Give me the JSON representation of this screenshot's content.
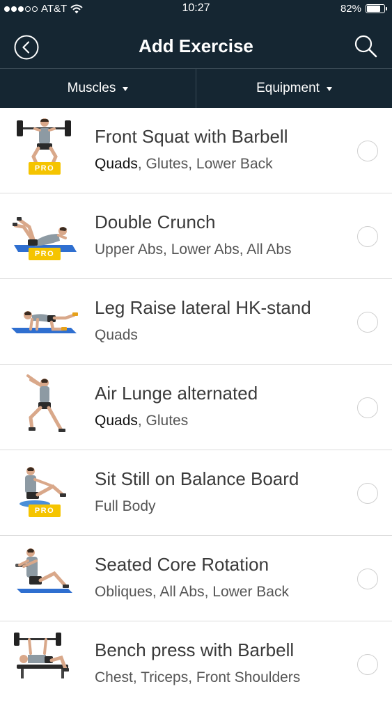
{
  "status_bar": {
    "carrier": "AT&T",
    "time": "10:27",
    "battery_percent": "82%",
    "battery_level": 0.82,
    "signal_bars_filled": 3,
    "signal_bars_total": 5
  },
  "navbar": {
    "title": "Add Exercise",
    "back_icon": "chevron-left-circle-icon",
    "search_icon": "search-icon"
  },
  "filters": {
    "muscles_label": "Muscles",
    "equipment_label": "Equipment"
  },
  "badge_label": "PRO",
  "colors": {
    "header_bg": "#152632",
    "pro_badge": "#f5c400",
    "mat_blue": "#2f6fd0"
  },
  "exercises": [
    {
      "name": "Front Squat with Barbell",
      "primary": "Quads",
      "secondary": ", Glutes, Lower Back",
      "pro": true,
      "illustration": "front-squat-barbell-figure"
    },
    {
      "name": "Double Crunch",
      "primary": "",
      "secondary": "Upper Abs, Lower Abs, All Abs",
      "pro": true,
      "illustration": "double-crunch-figure"
    },
    {
      "name": "Leg Raise lateral HK-stand",
      "primary": "",
      "secondary": "Quads",
      "pro": false,
      "illustration": "leg-raise-lateral-figure"
    },
    {
      "name": "Air Lunge alternated",
      "primary": "Quads",
      "secondary": ", Glutes",
      "pro": false,
      "illustration": "air-lunge-figure"
    },
    {
      "name": "Sit Still on Balance Board",
      "primary": "",
      "secondary": "Full Body",
      "pro": true,
      "illustration": "balance-board-figure"
    },
    {
      "name": "Seated Core Rotation",
      "primary": "",
      "secondary": "Obliques, All Abs, Lower Back",
      "pro": false,
      "illustration": "seated-core-rotation-figure"
    },
    {
      "name": "Bench press with Barbell",
      "primary": "",
      "secondary": "Chest, Triceps, Front Shoulders",
      "pro": false,
      "illustration": "bench-press-barbell-figure"
    }
  ]
}
